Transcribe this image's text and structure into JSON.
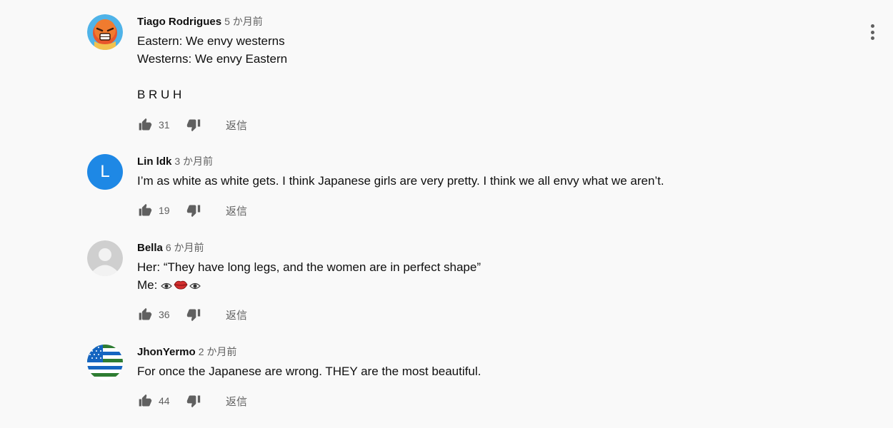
{
  "comments": [
    {
      "author": "Tiago Rodrigues",
      "time": "5 か月前",
      "lines": [
        "Eastern: We envy westerns",
        "Westerns: We envy Eastern",
        "",
        "B R U H"
      ],
      "likes": "31",
      "reply": "返信"
    },
    {
      "author": "Lin ldk",
      "avatar_letter": "L",
      "avatar_color": "#1e88e5",
      "time": "3 か月前",
      "lines": [
        "I’m as white as white gets. I think Japanese girls are very pretty. I think we all envy what we aren’t."
      ],
      "likes": "19",
      "reply": "返信"
    },
    {
      "author": "Bella",
      "time": "6 か月前",
      "lines": [
        "Her: “They have long legs, and the women are in perfect shape”",
        "Me: "
      ],
      "likes": "36",
      "reply": "返信"
    },
    {
      "author": "JhonYermo",
      "time": "2 か月前",
      "lines": [
        "For once the Japanese are wrong. THEY are the most beautiful."
      ],
      "likes": "44",
      "reply": "返信"
    }
  ],
  "icons": {
    "like": "thumb-up-icon",
    "dislike": "thumb-down-icon",
    "menu": "more-vertical-icon"
  },
  "colors": {
    "background": "#f9f9f9",
    "secondary_text": "#606060",
    "primary_text": "#0f0f0f"
  }
}
